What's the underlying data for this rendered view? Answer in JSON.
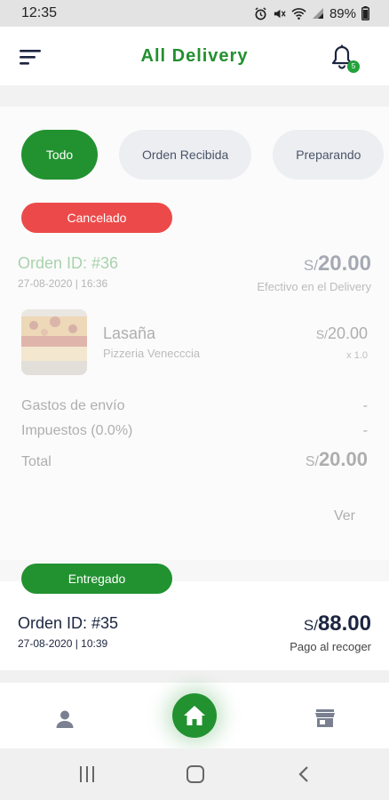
{
  "status_bar": {
    "time": "12:35",
    "battery": "89%"
  },
  "header": {
    "title": "All Delivery",
    "notification_count": "5"
  },
  "filters": [
    "Todo",
    "Orden Recibida",
    "Preparando"
  ],
  "orders": [
    {
      "status": "Cancelado",
      "status_color": "#ec4a4a",
      "id": "Orden ID: #36",
      "date": "27-08-2020 | 16:36",
      "currency": "S/",
      "total": "20.00",
      "payment": "Efectivo en el Delivery",
      "item": {
        "name": "Lasaña",
        "store": "Pizzeria Venecccia",
        "currency": "S/",
        "price": "20.00",
        "qty": "x 1.0"
      },
      "summary": {
        "shipping_label": "Gastos de envío",
        "shipping_value": "-",
        "tax_label": "Impuestos (0.0%)",
        "tax_value": "-",
        "total_label": "Total",
        "total_currency": "S/",
        "total_value": "20.00"
      },
      "link": "Ver"
    },
    {
      "status": "Entregado",
      "status_color": "#229230",
      "id": "Orden ID: #35",
      "date": "27-08-2020 | 10:39",
      "currency": "S/",
      "total": "88.00",
      "payment": "Pago al recoger"
    }
  ],
  "colors": {
    "brand_green": "#229230",
    "cancel_red": "#ec4a4a",
    "order_green": "#22902f"
  },
  "bottom_nav": {
    "left_icon": "user-icon",
    "center_icon": "home-icon",
    "right_icon": "store-icon"
  }
}
